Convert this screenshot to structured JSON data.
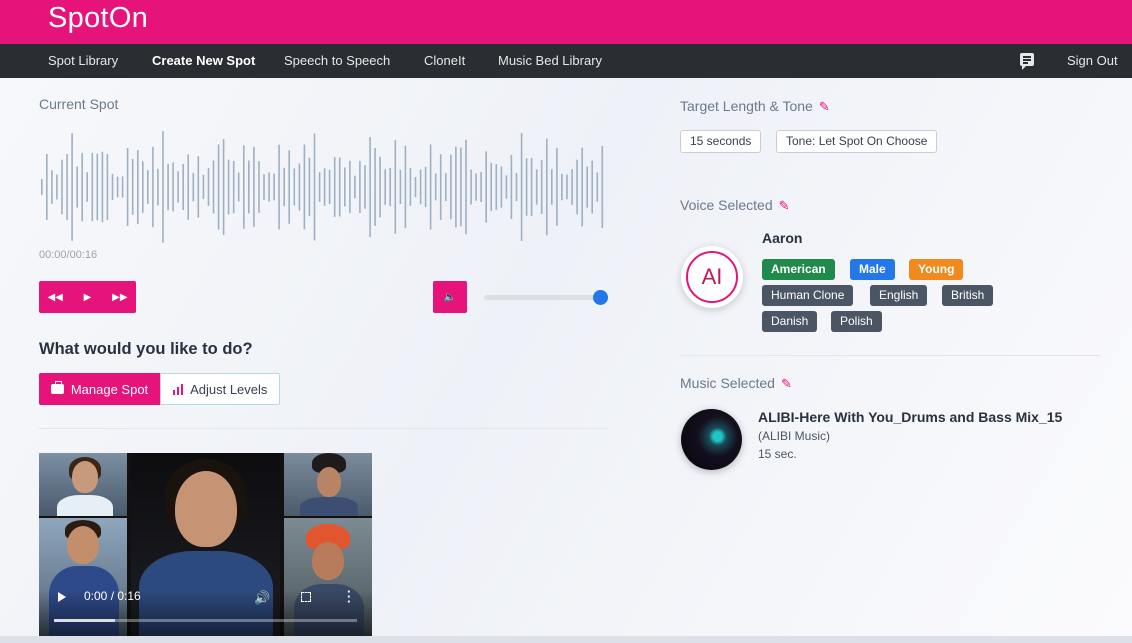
{
  "brand": {
    "logo": "SpotOn",
    "accent": "#e6137a"
  },
  "nav": {
    "items": [
      {
        "label": "Spot Library"
      },
      {
        "label": "Create New Spot"
      },
      {
        "label": "Speech to Speech"
      },
      {
        "label": "CloneIt"
      },
      {
        "label": "Music Bed Library"
      }
    ],
    "sign_out": "Sign Out",
    "chat_icon": "chat-icon"
  },
  "current_spot": {
    "label": "Current Spot",
    "time": "00:00/00:16",
    "volume_level": 0.93,
    "icons": [
      "rewind-icon",
      "play-icon",
      "fast-forward-icon",
      "volume-icon"
    ]
  },
  "actions": {
    "question": "What would you like to do?",
    "manage_label": "Manage Spot",
    "adjust_label": "Adjust Levels"
  },
  "video": {
    "time": "0:00 / 0:16",
    "progress": 0.2
  },
  "target": {
    "label": "Target Length & Tone",
    "length": "15 seconds",
    "tone": "Tone: Let Spot On Choose"
  },
  "voice": {
    "label": "Voice Selected",
    "initials": "AI",
    "name": "Aaron",
    "tags": [
      "American",
      "Male",
      "Young",
      "Human Clone",
      "English",
      "British",
      "Danish",
      "Polish"
    ]
  },
  "music": {
    "label": "Music Selected",
    "title": "ALIBI-Here With You_Drums and Bass Mix_15",
    "artist": "(ALIBI Music)",
    "duration": "15 sec."
  }
}
